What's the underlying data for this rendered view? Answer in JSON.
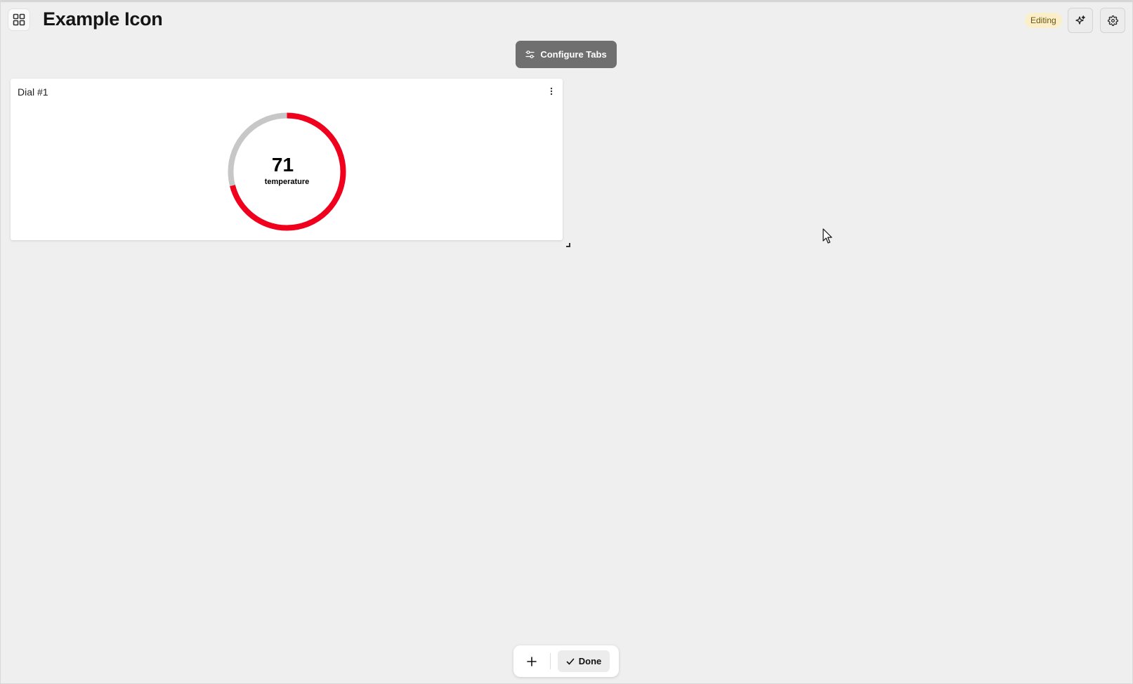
{
  "header": {
    "title": "Example Icon",
    "status_badge": "Editing",
    "apps_icon": "grid-icon",
    "ai_icon": "sparkle-icon",
    "settings_icon": "gear-icon"
  },
  "toolbar": {
    "configure_label": "Configure Tabs",
    "configure_icon": "sliders-icon"
  },
  "widget": {
    "title": "Dial #1",
    "menu_icon": "more-vertical-icon",
    "dial": {
      "value": "71",
      "label": "temperature",
      "fill_fraction": 0.71,
      "colors": {
        "fill": "#f0001c",
        "track": "#c7c7c7"
      }
    }
  },
  "bottom_bar": {
    "add_icon": "plus-icon",
    "done_label": "Done",
    "done_icon": "check-icon"
  }
}
